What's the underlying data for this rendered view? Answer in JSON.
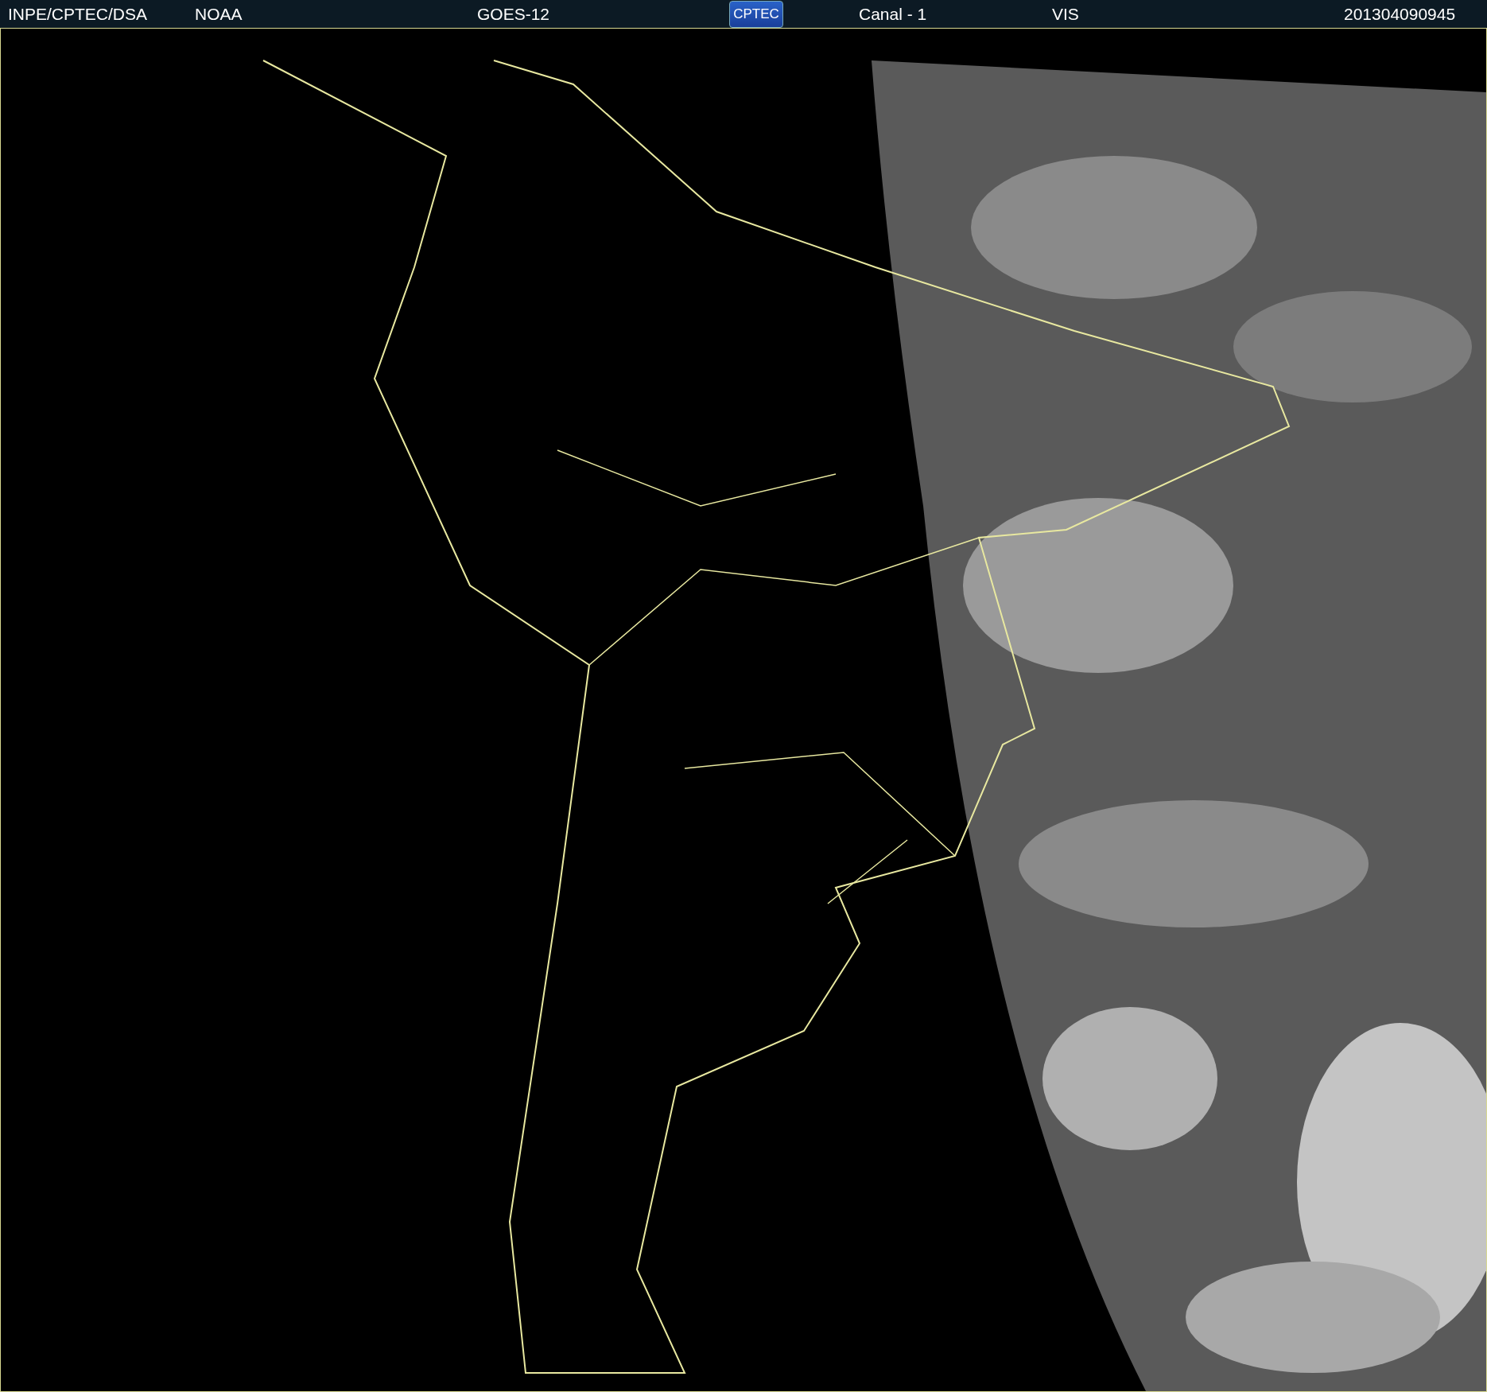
{
  "header": {
    "items": [
      {
        "kind": "text",
        "text": "INPE/CPTEC/DSA"
      },
      {
        "kind": "text",
        "text": "NOAA"
      },
      {
        "kind": "text",
        "text": "GOES-12"
      },
      {
        "kind": "logo",
        "text": "CPTEC"
      },
      {
        "kind": "text",
        "text": "Canal - 1"
      },
      {
        "kind": "text",
        "text": "VIS"
      },
      {
        "kind": "text",
        "text": "201304090945"
      }
    ]
  }
}
